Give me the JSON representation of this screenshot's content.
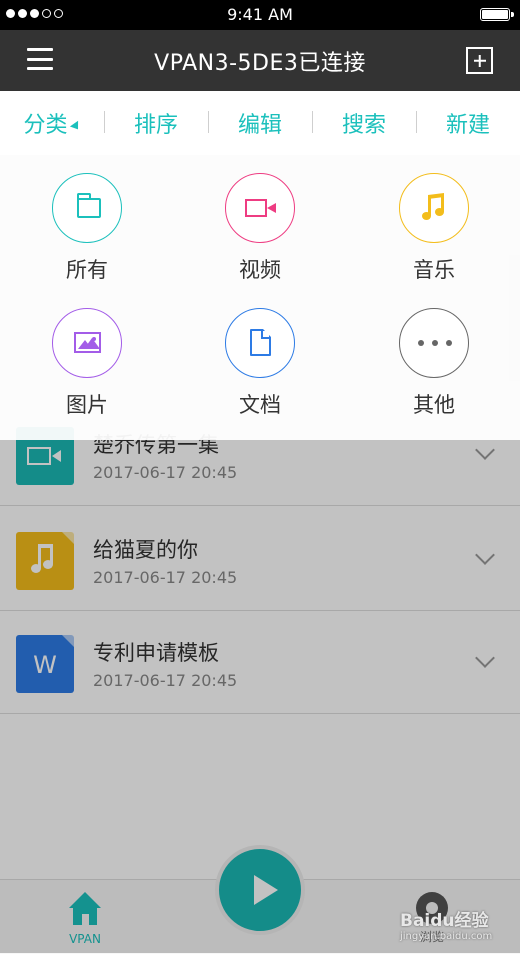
{
  "status_bar": {
    "time": "9:41 AM"
  },
  "nav": {
    "title": "VPAN3-5DE3已连接"
  },
  "toolbar": {
    "tabs": [
      {
        "label": "分类"
      },
      {
        "label": "排序"
      },
      {
        "label": "编辑"
      },
      {
        "label": "搜索"
      },
      {
        "label": "新建"
      }
    ]
  },
  "categories": [
    {
      "label": "所有",
      "icon": "folder-icon",
      "color": "#1bc0bc"
    },
    {
      "label": "视频",
      "icon": "video-icon",
      "color": "#ee3c82"
    },
    {
      "label": "音乐",
      "icon": "music-icon",
      "color": "#f3bd1b"
    },
    {
      "label": "图片",
      "icon": "image-icon",
      "color": "#a35ce8"
    },
    {
      "label": "文档",
      "icon": "document-icon",
      "color": "#2d7be5"
    },
    {
      "label": "其他",
      "icon": "more-icon",
      "color": "#666666"
    }
  ],
  "files": [
    {
      "name": "楚乔传第一集",
      "date": "2017-06-17 20:45",
      "icon": "video-file-icon",
      "color": "#1bb8b4"
    },
    {
      "name": "给猫夏的你",
      "date": "2017-06-17 20:45",
      "icon": "music-file-icon",
      "color": "#f3bd1b"
    },
    {
      "name": "专利申请模板",
      "date": "2017-06-17 20:45",
      "icon": "word-file-icon",
      "color": "#2d7be5",
      "badge": "W"
    }
  ],
  "tabbar": {
    "left_label": "VPAN",
    "right_label": "浏览"
  },
  "watermark": {
    "brand": "Baidu经验",
    "sub": "jingyan.baidu.com"
  },
  "accent_color": "#1bc0bc"
}
